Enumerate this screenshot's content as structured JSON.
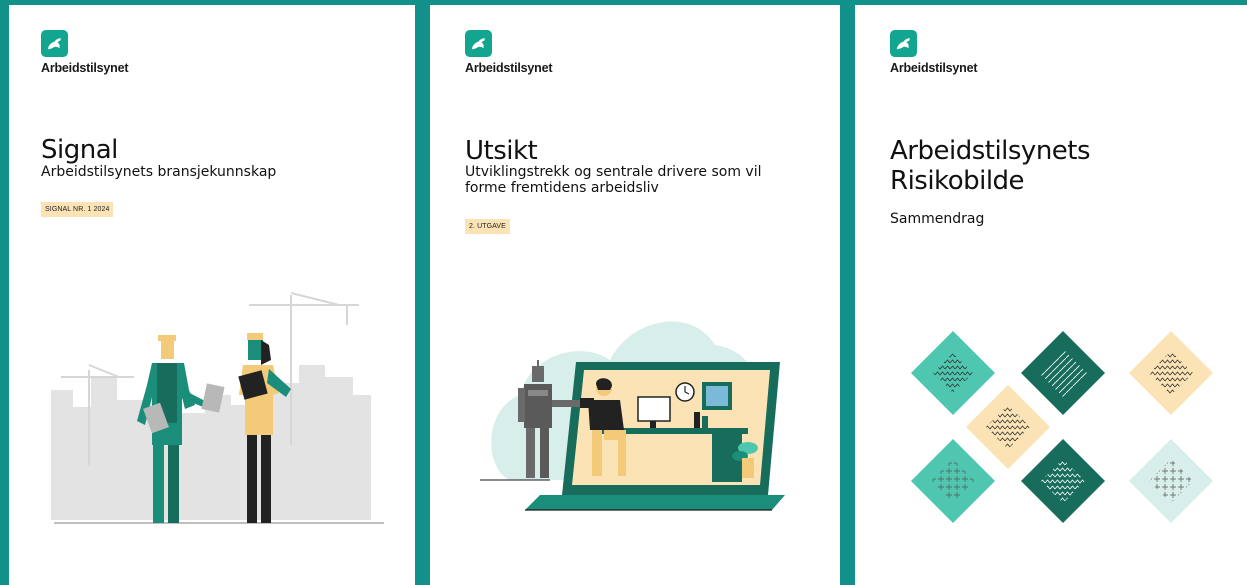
{
  "brand": {
    "name": "Arbeidstilsynet"
  },
  "colors": {
    "teal_background": "#12908a",
    "dark_green": "#176c5c",
    "mint": "#4fc7b0",
    "pale_yellow": "#fbe3b5",
    "pale_aqua": "#d8eeea",
    "silhouette_gray": "#e3e3e3"
  },
  "covers": [
    {
      "title": "Signal",
      "subtitle": "Arbeidstilsynets bransjekunnskap",
      "badge": "SIGNAL NR. 1 2024",
      "illustration": "two-workers-construction-site"
    },
    {
      "title": "Utsikt",
      "subtitle": "Utviklingstrekk og sentrale drivere som vil forme fremtidens arbeidsliv",
      "badge": "2. UTGAVE",
      "illustration": "robot-and-worker-laptop"
    },
    {
      "title": "Arbeidstilsynets Risikobilde",
      "subtitle": "Sammendrag",
      "illustration": "diamond-pattern-grid"
    }
  ]
}
